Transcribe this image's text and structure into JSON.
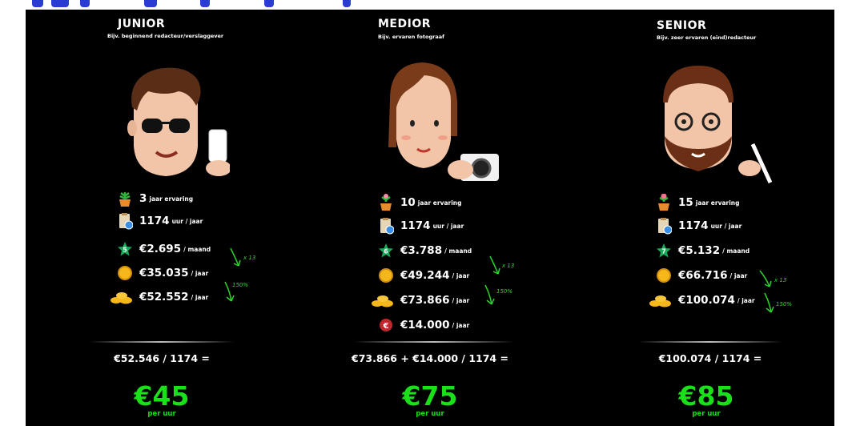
{
  "columns": [
    {
      "title": "JUNIOR",
      "subtitle": "Bijv. beginnend redacteur/verslaggever",
      "experience": {
        "value": "3",
        "unit": "jaar ervaring"
      },
      "hours": {
        "value": "1174",
        "unit": "uur / jaar"
      },
      "scale_badge": "5",
      "monthly": {
        "value": "€2.695",
        "unit": "/ maand"
      },
      "yearly": {
        "value": "€35.035",
        "unit": "/ jaar"
      },
      "yearly_total": {
        "value": "€52.552",
        "unit": "/ jaar"
      },
      "extra": null,
      "note_x13": "x 13",
      "note_150": "150%",
      "formula": "€52.546 / 1174 =",
      "rate": "€45",
      "rate_unit": "per uur"
    },
    {
      "title": "MEDIOR",
      "subtitle": "Bijv. ervaren fotograaf",
      "experience": {
        "value": "10",
        "unit": "jaar ervaring"
      },
      "hours": {
        "value": "1174",
        "unit": "uur / jaar"
      },
      "scale_badge": "6",
      "monthly": {
        "value": "€3.788",
        "unit": "/ maand"
      },
      "yearly": {
        "value": "€49.244",
        "unit": "/ jaar"
      },
      "yearly_total": {
        "value": "€73.866",
        "unit": "/ jaar"
      },
      "extra": {
        "value": "€14.000",
        "unit": "/ jaar"
      },
      "note_x13": "x 13",
      "note_150": "150%",
      "formula": "€73.866 + €14.000 / 1174 =",
      "rate": "€75",
      "rate_unit": "per uur"
    },
    {
      "title": "SENIOR",
      "subtitle": "Bijv. zeer ervaren (eind)redacteur",
      "experience": {
        "value": "15",
        "unit": "jaar ervaring"
      },
      "hours": {
        "value": "1174",
        "unit": "uur / jaar"
      },
      "scale_badge": "7",
      "monthly": {
        "value": "€5.132",
        "unit": "/ maand"
      },
      "yearly": {
        "value": "€66.716",
        "unit": "/ jaar"
      },
      "yearly_total": {
        "value": "€100.074",
        "unit": "/ jaar"
      },
      "extra": null,
      "note_x13": "x 13",
      "note_150": "150%",
      "formula": "€100.074 / 1174 =",
      "rate": "€85",
      "rate_unit": "per uur"
    }
  ],
  "colors": {
    "background": "#000000",
    "accent_green": "#19e019",
    "header_blue": "#2a3bd4"
  },
  "icons": [
    "plant-icon",
    "clipboard-clock-icon",
    "star-badge-icon",
    "coin-icon",
    "coin-stack-icon",
    "euro-badge-icon"
  ]
}
